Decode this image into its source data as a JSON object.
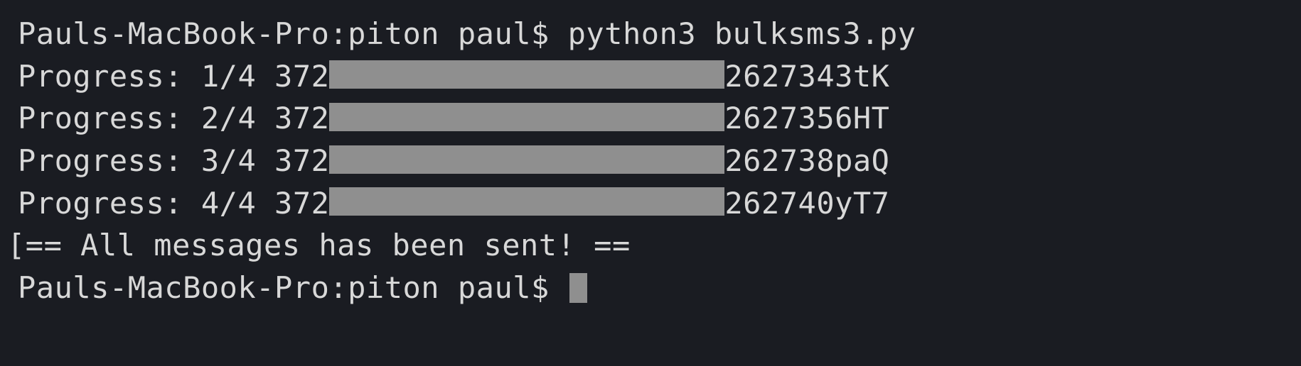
{
  "terminal": {
    "prompt": "Pauls-MacBook-Pro:piton paul$",
    "command": "python3 bulksms3.py",
    "progress_lines": [
      {
        "label": "Progress:",
        "count": "1/4",
        "prefix": "372",
        "suffix": "2627343tK"
      },
      {
        "label": "Progress:",
        "count": "2/4",
        "prefix": "372",
        "suffix": "2627356HT"
      },
      {
        "label": "Progress:",
        "count": "3/4",
        "prefix": "372",
        "suffix": "262738paQ"
      },
      {
        "label": "Progress:",
        "count": "4/4",
        "prefix": "372",
        "suffix": "262740yT7"
      }
    ],
    "completion_message": "== All messages has been sent! ==",
    "prompt2": "Pauls-MacBook-Pro:piton paul$"
  }
}
